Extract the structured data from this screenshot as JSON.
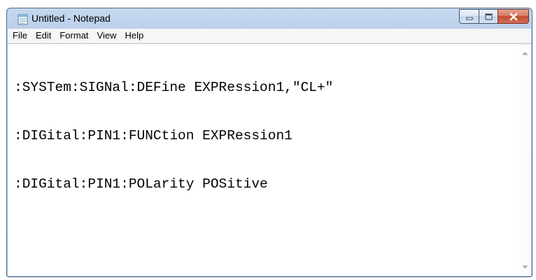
{
  "window": {
    "title": "Untitled - Notepad"
  },
  "icons": {
    "app": "notepad-icon",
    "minimize": "minimize-icon",
    "maximize": "maximize-icon",
    "close": "close-icon",
    "scroll_up": "chevron-up-icon",
    "scroll_down": "chevron-down-icon"
  },
  "menu": [
    "File",
    "Edit",
    "Format",
    "View",
    "Help"
  ],
  "editor": {
    "lines": [
      ":SYSTem:SIGNal:DEFine EXPRession1,\"CL+\"",
      ":DIGital:PIN1:FUNCtion EXPRession1",
      ":DIGital:PIN1:POLarity POSitive"
    ]
  },
  "colors": {
    "title_bar": "#b3cbe7",
    "close_button": "#c24a2e",
    "menu_bar": "#f5f6f7",
    "editor_bg": "#ffffff"
  }
}
